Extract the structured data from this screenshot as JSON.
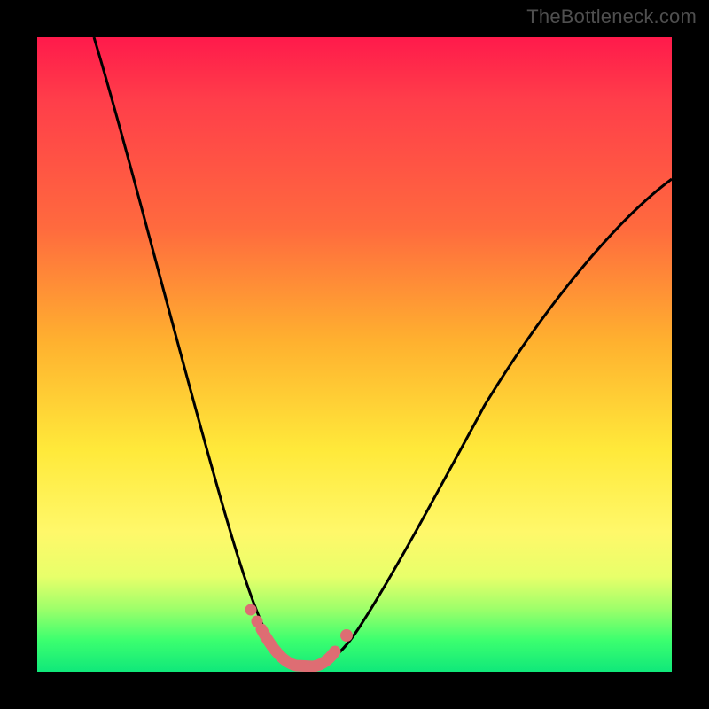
{
  "watermark": {
    "text": "TheBottleneck.com"
  },
  "chart_data": {
    "type": "line",
    "title": "",
    "xlabel": "",
    "ylabel": "",
    "xlim": [
      0,
      100
    ],
    "ylim": [
      0,
      100
    ],
    "grid": false,
    "legend": false,
    "series": [
      {
        "name": "curve",
        "color": "#000000",
        "x": [
          9,
          15,
          20,
          25,
          30,
          33,
          35,
          37,
          40,
          43,
          46,
          50,
          55,
          60,
          65,
          72,
          80,
          90,
          100
        ],
        "y": [
          100,
          77,
          60,
          45,
          28,
          18,
          12,
          7,
          3,
          1,
          1,
          3,
          9,
          18,
          27,
          40,
          52,
          65,
          76
        ]
      }
    ],
    "markers": [
      {
        "name": "bottom-segment",
        "color": "#de6d73",
        "x_range": [
          35,
          43
        ],
        "y": 1,
        "style": "thick"
      },
      {
        "name": "left-dots",
        "color": "#de6d73",
        "points": [
          [
            33,
            7
          ],
          [
            34,
            5
          ]
        ]
      },
      {
        "name": "right-dot",
        "color": "#de6d73",
        "points": [
          [
            46,
            5
          ]
        ]
      }
    ],
    "background_gradient": {
      "direction": "vertical",
      "stops": [
        {
          "pct": 0,
          "color": "#ff1a4b"
        },
        {
          "pct": 30,
          "color": "#ff6a3e"
        },
        {
          "pct": 65,
          "color": "#ffe93a"
        },
        {
          "pct": 90,
          "color": "#9fff6a"
        },
        {
          "pct": 100,
          "color": "#10e87a"
        }
      ]
    }
  }
}
